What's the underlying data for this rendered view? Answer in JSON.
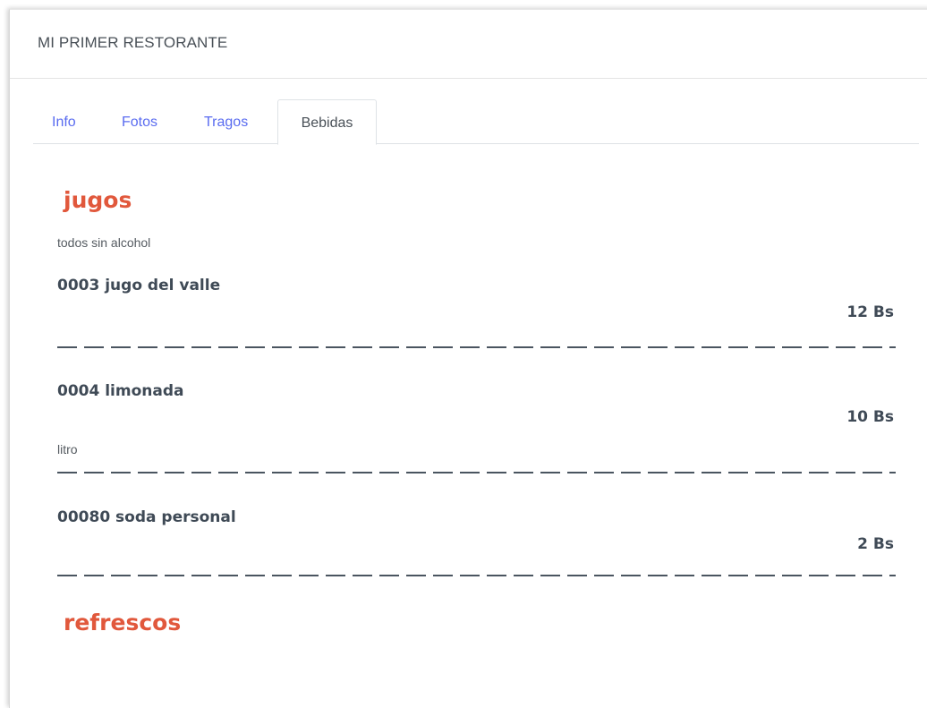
{
  "card": {
    "title": "MI PRIMER RESTORANTE"
  },
  "tabs": [
    {
      "label": "Info",
      "active": false
    },
    {
      "label": "Fotos",
      "active": false
    },
    {
      "label": "Tragos",
      "active": false
    },
    {
      "label": "Bebidas",
      "active": true
    }
  ],
  "categories": [
    {
      "name": "jugos",
      "description": "todos sin alcohol",
      "items": [
        {
          "name": "0003 jugo del valle",
          "price": "12 Bs",
          "note": ""
        },
        {
          "name": "0004 limonada",
          "price": "10 Bs",
          "note": "litro"
        },
        {
          "name": "00080 soda personal",
          "price": "2 Bs",
          "note": ""
        }
      ]
    },
    {
      "name": "refrescos",
      "description": "",
      "items": []
    }
  ],
  "colors": {
    "category": "#e1583c",
    "tab_link": "#5a6cf0",
    "text_dark": "#3f4a56"
  }
}
